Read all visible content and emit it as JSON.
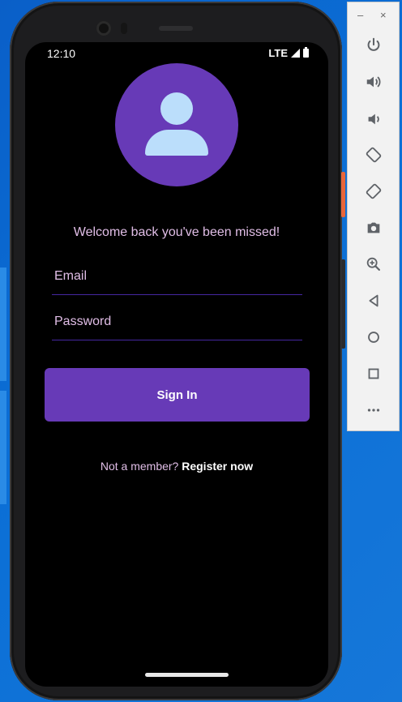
{
  "status_bar": {
    "time": "12:10",
    "network": "LTE"
  },
  "login": {
    "welcome_text": "Welcome back you've been missed!",
    "email_placeholder": "Email",
    "password_placeholder": "Password",
    "sign_in_label": "Sign In",
    "not_member_text": "Not a member? ",
    "register_label": "Register now"
  },
  "toolbar": {
    "minimize": "–",
    "close": "×",
    "buttons": [
      "power-icon",
      "volume-up-icon",
      "volume-down-icon",
      "rotate-left-icon",
      "rotate-right-icon",
      "camera-icon",
      "zoom-icon",
      "back-icon",
      "home-icon",
      "overview-icon",
      "more-icon"
    ]
  },
  "colors": {
    "accent": "#673ab7",
    "avatar_figure": "#bbdefb",
    "text_lilac": "#e1bee7",
    "toolbar_icon": "#5f6368"
  }
}
